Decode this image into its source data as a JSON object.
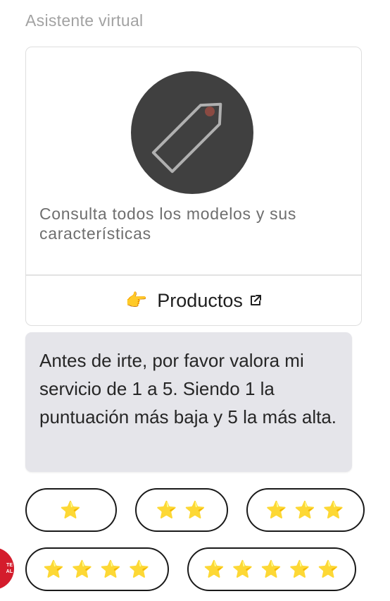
{
  "header": {
    "assistant_label": "Asistente virtual"
  },
  "card": {
    "image_icon": "price-tag-icon",
    "description": "Consulta todos los modelos y sus características",
    "link": {
      "emoji": "👉",
      "label": "Productos",
      "external_icon": "external-link-icon"
    }
  },
  "message": {
    "text": "Antes de irte, por favor valora mi servicio de 1 a 5. Siendo 1 la puntuación más baja y 5 la más alta."
  },
  "rating_options": [
    {
      "label": "⭐",
      "stars": 1
    },
    {
      "label": "⭐ ⭐",
      "stars": 2
    },
    {
      "label": "⭐ ⭐ ⭐",
      "stars": 3
    },
    {
      "label": "⭐ ⭐ ⭐ ⭐",
      "stars": 4
    },
    {
      "label": "⭐ ⭐ ⭐ ⭐ ⭐",
      "stars": 5
    }
  ],
  "avatar": {
    "text": "TE\nAL"
  },
  "colors": {
    "avatar_red": "#d41c2c",
    "bubble_bg": "#e5e5ea",
    "star": "#f5b800",
    "tag_circle": "#404040"
  }
}
